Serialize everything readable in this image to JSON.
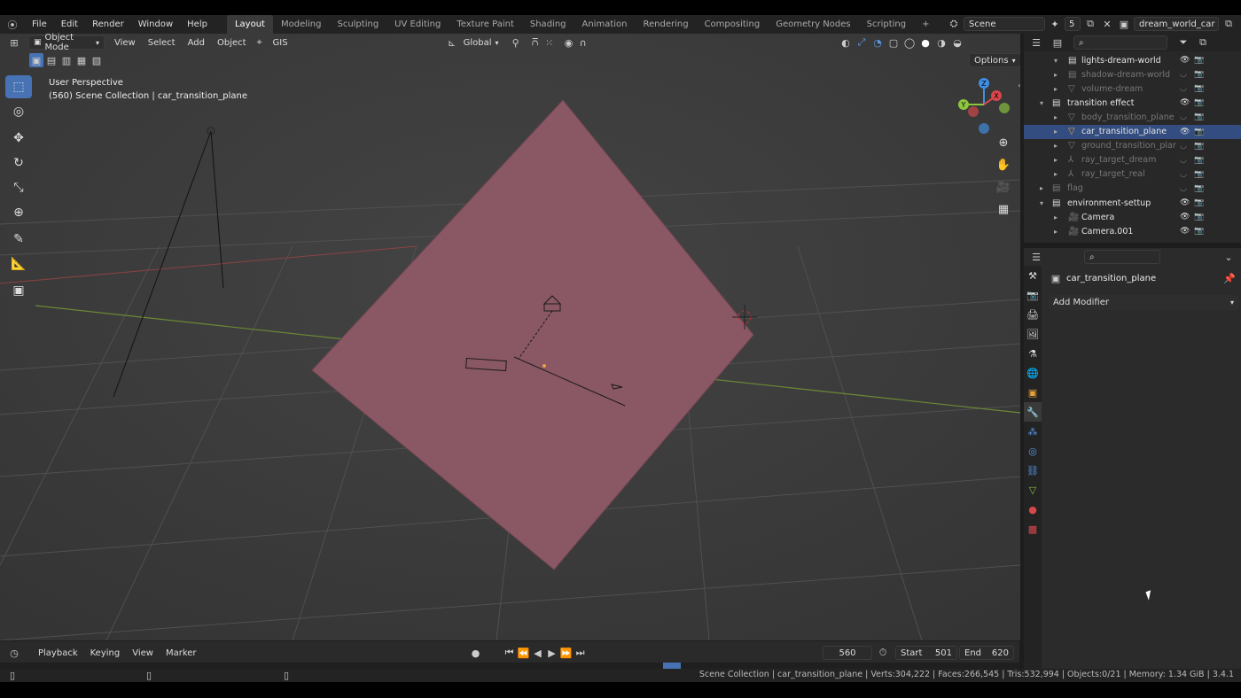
{
  "top_menu": [
    "File",
    "Edit",
    "Render",
    "Window",
    "Help"
  ],
  "workspace_tabs": [
    "Layout",
    "Modeling",
    "Sculpting",
    "UV Editing",
    "Texture Paint",
    "Shading",
    "Animation",
    "Rendering",
    "Compositing",
    "Geometry Nodes",
    "Scripting"
  ],
  "active_workspace": "Layout",
  "add_workspace": "+",
  "scene": {
    "name": "Scene",
    "users": "5"
  },
  "view_layer": {
    "name": "dream_world_car"
  },
  "viewport": {
    "mode": "Object Mode",
    "menus": [
      "View",
      "Select",
      "Add",
      "Object"
    ],
    "gis_label": "GIS",
    "transform_orientation": "Global",
    "options_label": "Options",
    "overlay_title": "User Perspective",
    "overlay_subtitle": "(560) Scene Collection | car_transition_plane",
    "gizmo": {
      "z": "Z",
      "y": "Y",
      "x": "X"
    },
    "plane_color": "#8a5865"
  },
  "outliner": {
    "rows": [
      {
        "label": "lights-dream-world",
        "indent": 2,
        "type": "collection",
        "muted": false
      },
      {
        "label": "shadow-dream-world",
        "indent": 2,
        "type": "collection",
        "muted": true
      },
      {
        "label": "volume-dream",
        "indent": 2,
        "type": "mesh",
        "muted": true
      },
      {
        "label": "transition effect",
        "indent": 1,
        "type": "collection",
        "muted": false
      },
      {
        "label": "body_transition_plane",
        "indent": 2,
        "type": "mesh",
        "muted": true
      },
      {
        "label": "car_transition_plane",
        "indent": 2,
        "type": "mesh",
        "muted": false
      },
      {
        "label": "ground_transition_plar",
        "indent": 2,
        "type": "mesh",
        "muted": true
      },
      {
        "label": "ray_target_dream",
        "indent": 2,
        "type": "empty",
        "muted": true
      },
      {
        "label": "ray_target_real",
        "indent": 2,
        "type": "empty",
        "muted": true
      },
      {
        "label": "flag",
        "indent": 1,
        "type": "collection",
        "muted": true
      },
      {
        "label": "environment-settup",
        "indent": 1,
        "type": "collection",
        "muted": false
      },
      {
        "label": "Camera",
        "indent": 2,
        "type": "camera",
        "muted": false
      },
      {
        "label": "Camera.001",
        "indent": 2,
        "type": "camera",
        "muted": false
      }
    ]
  },
  "properties": {
    "object_name": "car_transition_plane",
    "add_modifier_label": "Add Modifier"
  },
  "timeline": {
    "menus": [
      "Playback",
      "Keying",
      "View",
      "Marker"
    ],
    "current_frame": "560",
    "start_label": "Start",
    "start": "501",
    "end_label": "End",
    "end": "620"
  },
  "status": {
    "text": "Scene Collection | car_transition_plane | Verts:304,222 | Faces:266,545 | Tris:532,994 | Objects:0/21 | Memory: 1.34 GiB | 3.4.1"
  },
  "colors": {
    "accent": "#4772b3",
    "selection_orange": "#e8a13a",
    "x_axis": "#d8474b",
    "y_axis": "#8dc63f",
    "z_axis": "#3f8fe6"
  }
}
